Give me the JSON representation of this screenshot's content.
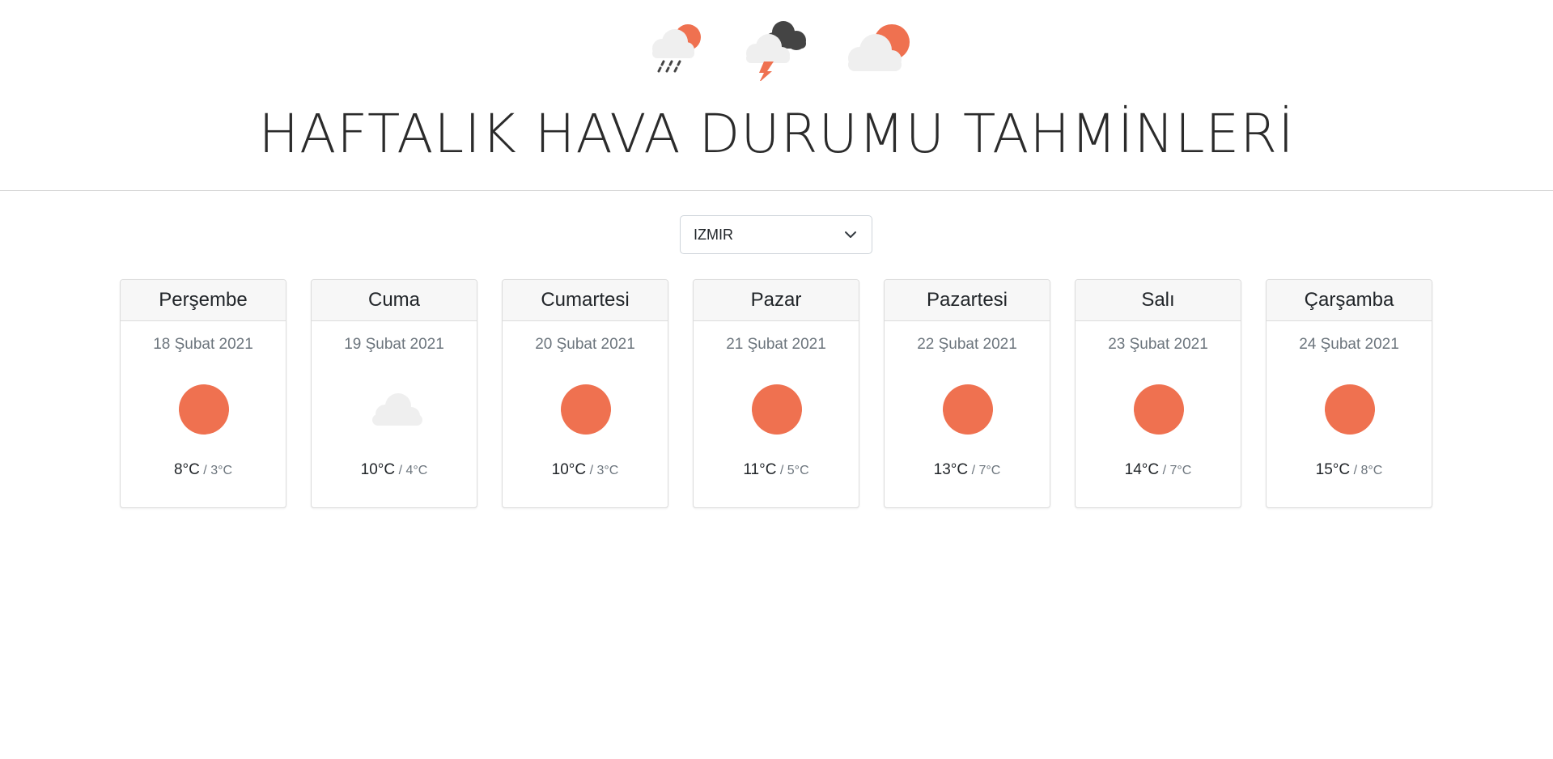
{
  "header": {
    "title": "HAFTALIK HAVA DURUMU TAHMİNLERİ",
    "icons": [
      "rain-sun-icon",
      "thunderstorm-icon",
      "partly-cloudy-icon"
    ]
  },
  "city_select": {
    "selected": "IZMIR",
    "icon": "chevron-down-icon"
  },
  "colors": {
    "sun": "#ef7150",
    "cloud": "#efefef",
    "dark_cloud": "#444444"
  },
  "days": [
    {
      "day": "Perşembe",
      "date": "18 Şubat 2021",
      "icon": "sun-icon",
      "high": "8°C",
      "sep": " / ",
      "low": "3°C"
    },
    {
      "day": "Cuma",
      "date": "19 Şubat 2021",
      "icon": "cloud-icon",
      "high": "10°C",
      "sep": " / ",
      "low": "4°C"
    },
    {
      "day": "Cumartesi",
      "date": "20 Şubat 2021",
      "icon": "sun-icon",
      "high": "10°C",
      "sep": " / ",
      "low": "3°C"
    },
    {
      "day": "Pazar",
      "date": "21 Şubat 2021",
      "icon": "sun-icon",
      "high": "11°C",
      "sep": " / ",
      "low": "5°C"
    },
    {
      "day": "Pazartesi",
      "date": "22 Şubat 2021",
      "icon": "sun-icon",
      "high": "13°C",
      "sep": " / ",
      "low": "7°C"
    },
    {
      "day": "Salı",
      "date": "23 Şubat 2021",
      "icon": "sun-icon",
      "high": "14°C",
      "sep": " / ",
      "low": "7°C"
    },
    {
      "day": "Çarşamba",
      "date": "24 Şubat 2021",
      "icon": "sun-icon",
      "high": "15°C",
      "sep": " / ",
      "low": "8°C"
    }
  ]
}
